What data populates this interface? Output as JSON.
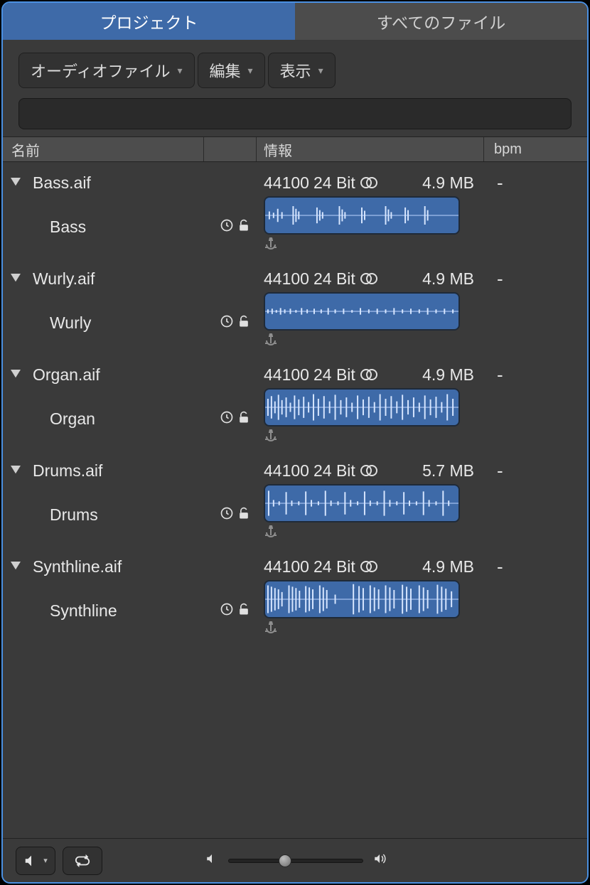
{
  "tabs": {
    "project": "プロジェクト",
    "allfiles": "すべてのファイル"
  },
  "toolbar": {
    "audio_files": "オーディオファイル",
    "edit": "編集",
    "view": "表示"
  },
  "columns": {
    "name": "名前",
    "info": "情報",
    "bpm": "bpm"
  },
  "files": {
    "0": {
      "filename": "Bass.aif",
      "region": "Bass",
      "samplerate": "44100",
      "bitdepth": "24 Bit",
      "size": "4.9 MB",
      "bpm": "-"
    },
    "1": {
      "filename": "Wurly.aif",
      "region": "Wurly",
      "samplerate": "44100",
      "bitdepth": "24 Bit",
      "size": "4.9 MB",
      "bpm": "-"
    },
    "2": {
      "filename": "Organ.aif",
      "region": "Organ",
      "samplerate": "44100",
      "bitdepth": "24 Bit",
      "size": "4.9 MB",
      "bpm": "-"
    },
    "3": {
      "filename": "Drums.aif",
      "region": "Drums",
      "samplerate": "44100",
      "bitdepth": "24 Bit",
      "size": "5.7 MB",
      "bpm": "-"
    },
    "4": {
      "filename": "Synthline.aif",
      "region": "Synthline",
      "samplerate": "44100",
      "bitdepth": "24 Bit",
      "size": "4.9 MB",
      "bpm": "-"
    }
  },
  "icons": {
    "disclosure": "chevron-down",
    "clock": "clock-icon",
    "lock": "unlock-icon",
    "stereo": "stereo-icon",
    "anchor": "anchor-icon",
    "speaker": "speaker-icon",
    "loop": "loop-icon",
    "vol_low": "volume-low-icon",
    "vol_high": "volume-high-icon"
  },
  "volume": {
    "position_pct": 42
  }
}
